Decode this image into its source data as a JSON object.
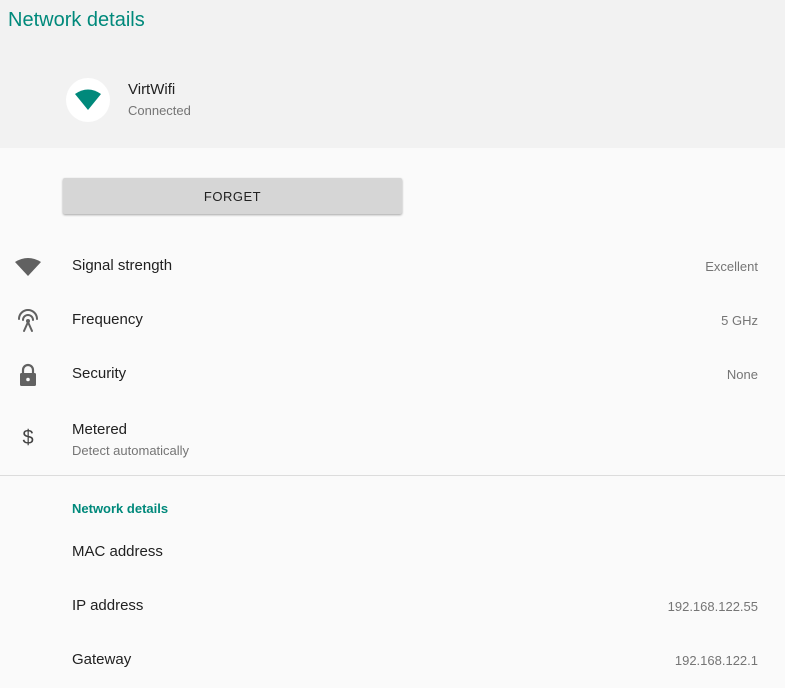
{
  "page": {
    "title": "Network details"
  },
  "network": {
    "name": "VirtWifi",
    "status": "Connected",
    "icon": "wifi-icon"
  },
  "actions": {
    "forget_label": "FORGET"
  },
  "details": [
    {
      "label": "Signal strength",
      "value": "Excellent",
      "icon": "wifi-signal-icon"
    },
    {
      "label": "Frequency",
      "value": "5 GHz",
      "icon": "antenna-icon"
    },
    {
      "label": "Security",
      "value": "None",
      "icon": "lock-icon"
    },
    {
      "label": "Metered",
      "sub": "Detect automatically",
      "icon": "dollar-icon"
    }
  ],
  "section": {
    "title": "Network details",
    "items": [
      {
        "label": "MAC address",
        "value": ""
      },
      {
        "label": "IP address",
        "value": "192.168.122.55"
      },
      {
        "label": "Gateway",
        "value": "192.168.122.1"
      }
    ]
  },
  "colors": {
    "accent": "#00897b",
    "icon_gray": "#616161"
  }
}
